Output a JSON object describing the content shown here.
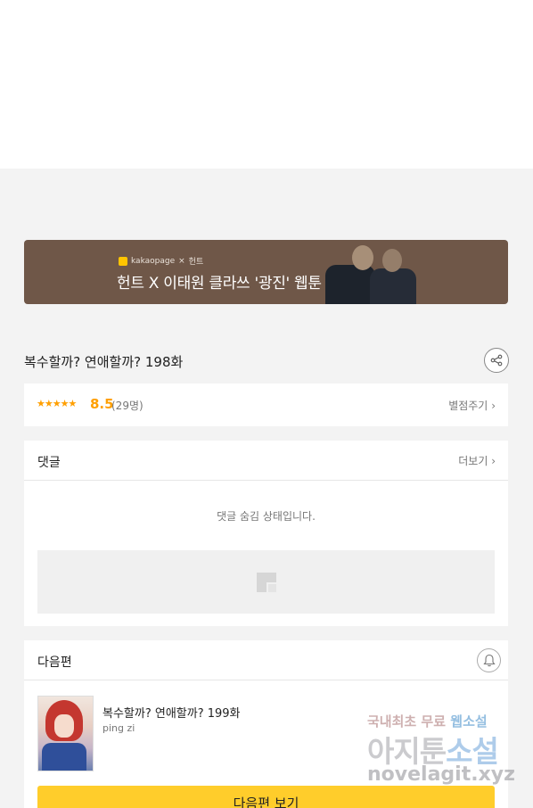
{
  "banner": {
    "brand_logo_text": "kakaopage",
    "brand_sep": "×",
    "brand_partner": "헌트",
    "title": "헌트 X 이태원 클라쓰 '광진' 웹툰"
  },
  "episode": {
    "title": "복수할까? 연애할까? 198화",
    "share_icon": "share-icon"
  },
  "rating": {
    "stars": "★★★★★",
    "score": "8.5",
    "count": "(29명)",
    "rate_label": "별점주기",
    "chevron": "›"
  },
  "comments": {
    "label": "댓글",
    "more_label": "더보기",
    "chevron": "›",
    "hidden_message": "댓글 숨김 상태입니다."
  },
  "next": {
    "label": "다음편",
    "bell_icon": "bell-icon",
    "title": "복수할까? 연애할까? 199화",
    "author": "ping zi",
    "button_label": "다음편 보기"
  },
  "watermark": {
    "line1_a": "국내최초 무료",
    "line1_b": "웹소설",
    "line2_a": "아지툰",
    "line2_b": "소설",
    "line3": "novelagit.xyz"
  },
  "colors": {
    "accent_yellow": "#ffcd2b",
    "rating_orange": "#ff9f00",
    "banner_brown": "#6f5748"
  }
}
